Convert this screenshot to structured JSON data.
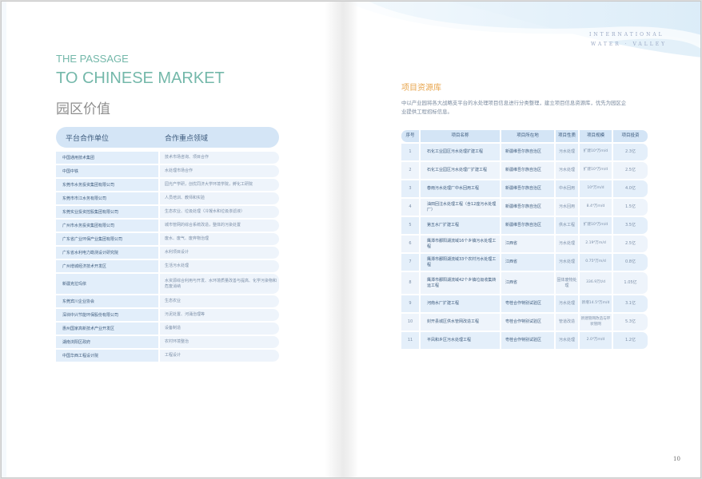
{
  "corner": {
    "line1": "INTERNATIONAL",
    "line2": "WATER  ·  VALLEY"
  },
  "left": {
    "kicker": "THE PASSAGE",
    "headline": "TO CHINESE MARKET",
    "section_title": "园区价值",
    "table": {
      "headers": [
        "平台合作单位",
        "合作重点领域"
      ],
      "rows": [
        [
          "中国通用技术集团",
          "技术市场咨询、项目合作"
        ],
        [
          "中国中铁",
          "水处理市场合作"
        ],
        [
          "东莞市水务投资集团有限公司",
          "园光产学研，创优同济大学环境学院，孵化工研院"
        ],
        [
          "东莞市市江水务有限公司",
          "人员培训、教师和实验"
        ],
        [
          "东莞实业投资控股集团有限公司",
          "生态农业、垃圾处理（冷凝水和垃圾渗滤液）"
        ],
        [
          "广州市水务投资集团有限公司",
          "城市管网的综合系统改造，整体的污染处置"
        ],
        [
          "广东省广业环保产业集团有限公司",
          "废水、废气、废弃物治理"
        ],
        [
          "广东省水利电力勘测设计研究院",
          "水利项目设计"
        ],
        [
          "广州增城经济技术开发区",
          "生活污水处理"
        ],
        [
          "新疆克拉玛依",
          "水资源综合利用与开发、水环境质量改善与提高、化学污染物和危废消纳"
        ],
        [
          "东莞宾川企业协会",
          "生态农业"
        ],
        [
          "深圳中兴节能环保股份有限公司",
          "污泥处置、河涌治理等"
        ],
        [
          "惠州国家高新技术产业开发区",
          "设备制造"
        ],
        [
          "湖南浏阳区政府",
          "农村环境整治"
        ],
        [
          "中国华西工程设计院",
          "工程设计"
        ]
      ]
    }
  },
  "right": {
    "title": "项目资源库",
    "intro": "中以产业园将各大战略支平台的水处理项目信息进行分类整理，建立项目信息资源库，优先为园区企业提供工程招标信息。",
    "table": {
      "headers": [
        "序号",
        "项目名称",
        "项目所在地",
        "项目性质",
        "项目规模",
        "项目投资"
      ],
      "rows": [
        [
          "1",
          "石化工业园区污水处理扩建工程",
          "新疆维吾尔族自治区",
          "污水处理",
          "扩建10⁴万m/d",
          "2.3亿"
        ],
        [
          "2",
          "石化工业园区污水处理厂扩建工程",
          "新疆维吾尔族自治区",
          "污水处理",
          "扩建10⁴万m/d",
          "2.5亿"
        ],
        [
          "3",
          "春雨污水处理厂中水回用工程",
          "新疆维吾尔族自治区",
          "中水回用",
          "10⁴万m/d",
          "4.0亿"
        ],
        [
          "4",
          "油田回注水处理工程（含12座污水处理厂）",
          "新疆维吾尔族自治区",
          "污水回用",
          "8.4⁴万m/d",
          "1.5亿"
        ],
        [
          "5",
          "第五水厂扩建工程",
          "新疆维吾尔族自治区",
          "供水工程",
          "扩建10⁴万m/d",
          "3.5亿"
        ],
        [
          "6",
          "鹰潭市鄱阳湖流域16个乡镇污水处理工程",
          "江西省",
          "污水处理",
          "2.19⁴万m/d",
          "2.5亿"
        ],
        [
          "7",
          "鹰潭市鄱阳湖流域33个农村污水处理工程",
          "江西省",
          "污水处理",
          "0.75⁴万m/d",
          "0.8亿"
        ],
        [
          "8",
          "鹰潭市鄱阳湖流域42个乡镇垃圾收集转运工程",
          "江西省",
          "固体废物处理",
          "336.9万t/d",
          "1.05亿"
        ],
        [
          "9",
          "河南水厂扩建工程",
          "粤桂合作特别试验区",
          "污水处理",
          "新增14.5⁴万m/d",
          "3.1亿"
        ],
        [
          "10",
          "封开县城区供水管网改造工程",
          "粤桂合作特别试验区",
          "管道改造",
          "新建管网改造与环状管网",
          "5.3亿"
        ],
        [
          "11",
          "平凤和乡区污水处理工程",
          "粤桂合作特别试验区",
          "污水处理",
          "2.0⁴万m/d",
          "1.2亿"
        ]
      ]
    }
  },
  "page_number": "10",
  "colors": {
    "accent_teal": "#74b8aa",
    "accent_orange": "#e8a64e",
    "header_blue": "#d4e5f6",
    "cell_blue": "#e2eefa",
    "text_navy": "#3d5b7d"
  }
}
